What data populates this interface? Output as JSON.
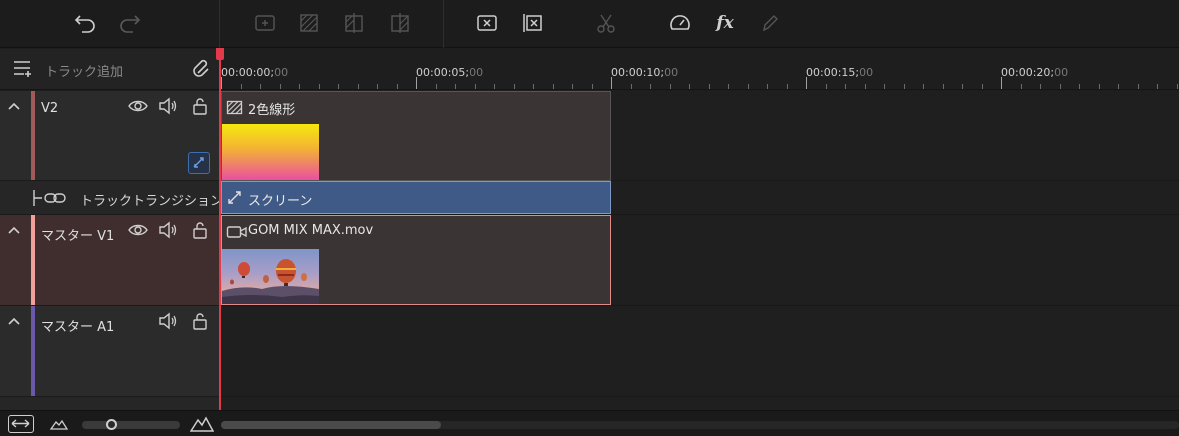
{
  "toolbar": {
    "buttons": [
      {
        "name": "undo",
        "enabled": true
      },
      {
        "name": "redo",
        "enabled": false
      },
      {
        "name": "add-media",
        "enabled": false
      },
      {
        "name": "transition",
        "enabled": false
      },
      {
        "name": "split",
        "enabled": false
      },
      {
        "name": "split-right",
        "enabled": false
      },
      {
        "name": "delete",
        "enabled": true
      },
      {
        "name": "delete-gap",
        "enabled": true
      },
      {
        "name": "cut",
        "enabled": false
      },
      {
        "name": "speed",
        "enabled": true
      },
      {
        "name": "effects",
        "enabled": true
      },
      {
        "name": "edit",
        "enabled": false
      }
    ],
    "fx_label": "fx"
  },
  "header": {
    "add_track_label": "トラック追加"
  },
  "ruler": {
    "labels": [
      {
        "main": "00:00:00;",
        "sub": "00"
      },
      {
        "main": "00:00:05;",
        "sub": "00"
      },
      {
        "main": "00:00:10;",
        "sub": "00"
      },
      {
        "main": "00:00:15;",
        "sub": "00"
      },
      {
        "main": "00:00:20;",
        "sub": "00"
      }
    ]
  },
  "tracks": {
    "v2": {
      "name": "V2",
      "color": "#a05a5a",
      "clip_title": "2色線形"
    },
    "transition": {
      "name": "トラックトランジション",
      "clip_title": "スクリーン"
    },
    "v1": {
      "name": "マスター V1",
      "color": "#f2a09a",
      "clip_title": "GOM MIX MAX.mov"
    },
    "a1": {
      "name": "マスター A1",
      "color": "#6a58a8"
    }
  },
  "colors": {
    "playhead": "#e33a4b",
    "transition_clip": "#3f5a86",
    "clip_bg": "#3a3434"
  },
  "zoom": {
    "level": 0.28
  },
  "scroll": {
    "position": 0,
    "visible_fraction": 0.23
  }
}
